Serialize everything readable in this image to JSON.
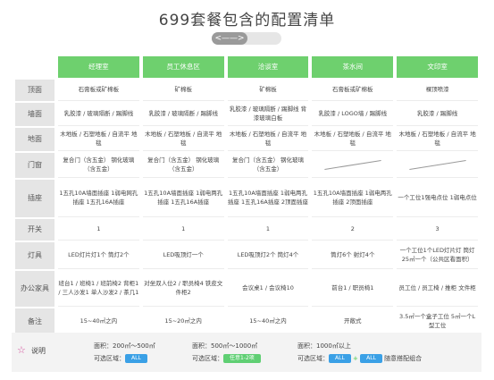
{
  "title": "699套餐包含的配置清单",
  "slider": {
    "label": "<——>"
  },
  "columns": [
    "经理室",
    "员工休息区",
    "洽谈室",
    "茶水间",
    "文印室"
  ],
  "rows": [
    {
      "label": "顶面",
      "cells": [
        "石膏板或矿棉板",
        "矿棉板",
        "矿棉板",
        "石膏板或矿棉板",
        "裸顶喷漆"
      ]
    },
    {
      "label": "墙面",
      "cells": [
        "乳胶漆 / 玻璃隔断 / 踢脚线",
        "乳胶漆 / 玻璃隔断 / 踢脚线",
        "乳胶漆 / 玻璃隔断 / 踢脚线 背漆玻璃白板",
        "乳胶漆 / LOGO墙 / 踢脚线",
        "乳胶漆 / 踢脚线"
      ]
    },
    {
      "label": "地面",
      "cells": [
        "木地板 / 石塑地板 / 自流平 地毯",
        "木地板 / 石塑地板 / 自流平 地毯",
        "木地板 / 石塑地板 / 自流平 地毯",
        "木地板 / 石塑地板 / 自流平 地毯",
        "木地板 / 石塑地板 / 自流平 地毯"
      ]
    },
    {
      "label": "门窗",
      "cells": [
        "复合门（含五金） 钢化玻璃（含五金）",
        "复合门（含五金） 钢化玻璃（含五金）",
        "复合门（含五金） 钢化玻璃（含五金）",
        "",
        ""
      ]
    },
    {
      "label": "插座",
      "cells": [
        "1五孔10A墙面插座 1弱电网孔插座 1五孔16A插座",
        "1五孔10A墙面插座 1弱电两孔插座 1五孔16A插座",
        "1五孔10A墙面插座 1弱电两孔插座 1五孔16A插座 2顶面插座",
        "1五孔10A墙面插座 1弱电两孔插座 2顶面插座",
        "一个工位1强电点位 1弱电点位"
      ]
    },
    {
      "label": "开关",
      "cells": [
        "1",
        "1",
        "1",
        "2",
        "3"
      ]
    },
    {
      "label": "灯具",
      "cells": [
        "LED灯片灯1个 筒灯2个",
        "LED吸顶灯一个",
        "LED吸顶灯2个 筒灯4个",
        "筒灯6个 射灯4个",
        "一个工位1个LED灯片灯 筒灯25㎡一个（公共区看面积）"
      ]
    },
    {
      "label": "办公家具",
      "cells": [
        "班台1 / 班椅1 / 班前椅2 背柜1 / 三人沙发1 单人沙发2 / 茶几1",
        "对坐双人位2 / 职员椅4 铁皮文件柜2",
        "会议桌1 / 会议椅10",
        "前台1 / 职员椅1",
        "员工位 / 员工椅 / 推柜 文件柜"
      ]
    },
    {
      "label": "备注",
      "cells": [
        "15~40㎡之内",
        "15~20㎡之内",
        "15~40㎡之内",
        "开敞式",
        "3.5㎡一个盒子工位 5㎡一个L型工位"
      ]
    }
  ],
  "footer": {
    "label": "说明",
    "area_prefix": "面积：",
    "select_prefix": "可选区域：",
    "blocks": [
      {
        "area": "200㎡～500㎡",
        "badge": "ALL"
      },
      {
        "area": "500㎡～1000㎡",
        "badge": "任意1-2项"
      },
      {
        "area": "1000㎡以上",
        "badge": "ALL",
        "plus": "+",
        "badge2": "ALL",
        "tail": "随意搭配组合"
      }
    ]
  },
  "colors": {
    "header_green": "#6ed06e",
    "badge_blue": "#3aa0e6",
    "badge_green": "#5fcf73",
    "star": "#d44c9a"
  }
}
